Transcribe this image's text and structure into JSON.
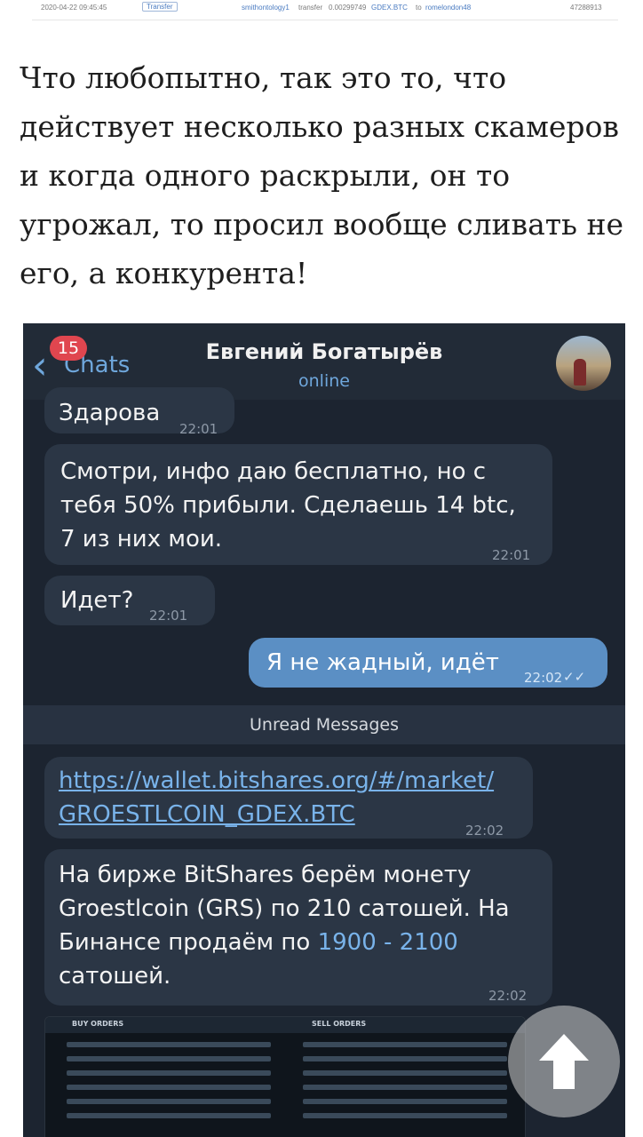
{
  "transaction": {
    "datetime": "2020-04-22 09:45:45",
    "type": "Transfer",
    "from": "smithontology1",
    "action": "transfer",
    "amount": "0.00299749",
    "asset": "GDEX.BTC",
    "to_word": "to",
    "to": "romelondon48",
    "id": "47288913"
  },
  "article": {
    "text": "Что любопытно, так это то, что действует несколько разных скамеров и когда одного раскрыли, он то угрожал, то просил вообще сливать не его, а конкурента!"
  },
  "chat": {
    "back_label": "Chats",
    "unread_count": "15",
    "contact_name": "Евгений Богатырёв",
    "status": "online",
    "messages": [
      {
        "text": "Здарова",
        "time": "22:01"
      },
      {
        "text_1": "Смотри, инфо даю бесплатно, но с",
        "text_2": "тебя 50% прибыли. Сделаешь 14 btc,",
        "text_3": "7 из них мои.",
        "time": "22:01"
      },
      {
        "text": "Идет?",
        "time": "22:01"
      },
      {
        "text": "Я не жадный, идёт",
        "time": "22:02",
        "check": "✓✓"
      },
      {
        "link_1": "https://wallet.bitshares.org/#/market/",
        "link_2": "GROESTLCOIN_GDEX.BTC",
        "time": "22:02"
      },
      {
        "text_1": "На бирже BitShares берём монету",
        "text_2": "Groestlcoin (GRS) по 210 сатошей. На",
        "text_3a": "Бинансе продаём по ",
        "text_3b": "1900 - 2100",
        "text_4": "сатошей.",
        "time": "22:02"
      }
    ],
    "unread_label": "Unread Messages",
    "table_headers": {
      "buy": "BUY ORDERS",
      "sell": "SELL ORDERS"
    }
  },
  "colors": {
    "chat_bg": "#1c2430",
    "bubble_in": "#2b3645",
    "bubble_out": "#5b8fc4",
    "accent": "#79b3ea",
    "badge": "#e0464f"
  },
  "icons": {
    "back": "chevron-left-icon",
    "scroll": "arrow-up-icon"
  }
}
